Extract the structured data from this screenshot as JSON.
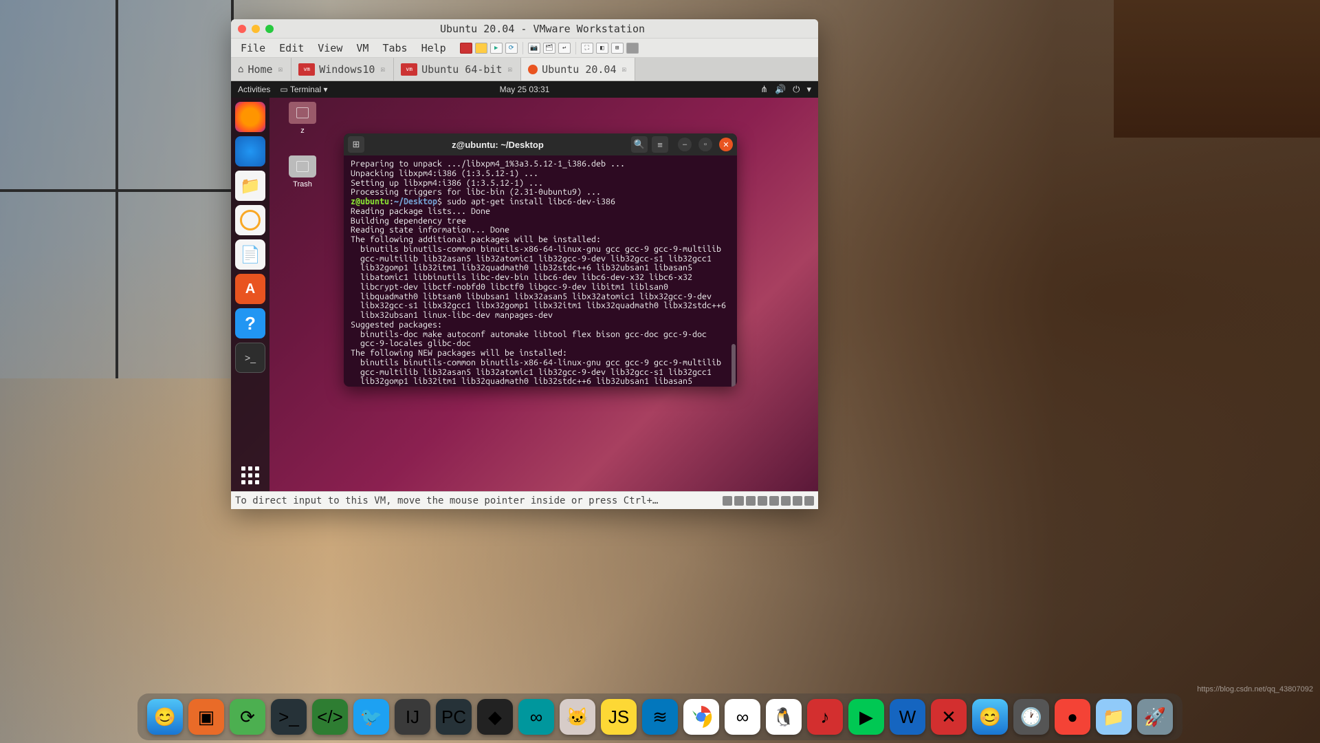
{
  "vmware": {
    "title": "Ubuntu 20.04 - VMware Workstation",
    "menu": {
      "file": "File",
      "edit": "Edit",
      "view": "View",
      "vm": "VM",
      "tabs": "Tabs",
      "help": "Help"
    },
    "tabs": [
      {
        "label": "Home"
      },
      {
        "label": "Windows10"
      },
      {
        "label": "Ubuntu 64-bit"
      },
      {
        "label": "Ubuntu 20.04"
      }
    ],
    "statusbar_text": "To direct input to this VM, move the mouse pointer inside or press Ctrl+…"
  },
  "ubuntu": {
    "topbar": {
      "activities": "Activities",
      "app": "Terminal",
      "clock": "May 25  03:31"
    },
    "desktop_icons": [
      {
        "label": "z"
      },
      {
        "label": "Trash"
      }
    ],
    "terminal": {
      "title": "z@ubuntu: ~/Desktop",
      "prompt_user": "z@ubuntu",
      "prompt_path": "~/Desktop",
      "prompt_sep": ":",
      "prompt_end": "$",
      "command": "sudo apt-get install libc6-dev-i386",
      "lines_pre": [
        "Preparing to unpack .../libxpm4_1%3a3.5.12-1_i386.deb ...",
        "Unpacking libxpm4:i386 (1:3.5.12-1) ...",
        "Setting up libxpm4:i386 (1:3.5.12-1) ...",
        "Processing triggers for libc-bin (2.31-0ubuntu9) ..."
      ],
      "lines_post": [
        "Reading package lists... Done",
        "Building dependency tree",
        "Reading state information... Done",
        "The following additional packages will be installed:",
        "  binutils binutils-common binutils-x86-64-linux-gnu gcc gcc-9 gcc-9-multilib",
        "  gcc-multilib lib32asan5 lib32atomic1 lib32gcc-9-dev lib32gcc-s1 lib32gcc1",
        "  lib32gomp1 lib32itm1 lib32quadmath0 lib32stdc++6 lib32ubsan1 libasan5",
        "  libatomic1 libbinutils libc-dev-bin libc6-dev libc6-dev-x32 libc6-x32",
        "  libcrypt-dev libctf-nobfd0 libctf0 libgcc-9-dev libitm1 liblsan0",
        "  libquadmath0 libtsan0 libubsan1 libx32asan5 libx32atomic1 libx32gcc-9-dev",
        "  libx32gcc-s1 libx32gcc1 libx32gomp1 libx32itm1 libx32quadmath0 libx32stdc++6",
        "  libx32ubsan1 linux-libc-dev manpages-dev",
        "Suggested packages:",
        "  binutils-doc make autoconf automake libtool flex bison gcc-doc gcc-9-doc",
        "  gcc-9-locales glibc-doc",
        "The following NEW packages will be installed:",
        "  binutils binutils-common binutils-x86-64-linux-gnu gcc gcc-9 gcc-9-multilib",
        "  gcc-multilib lib32asan5 lib32atomic1 lib32gcc-9-dev lib32gcc-s1 lib32gcc1",
        "  lib32gomp1 lib32itm1 lib32quadmath0 lib32stdc++6 lib32ubsan1 libasan5"
      ]
    }
  },
  "watermark": "https://blog.csdn.net/qq_43807092",
  "host_dock": {
    "items": [
      {
        "name": "finder",
        "bg": "linear-gradient(#4fc3f7,#1976d2)"
      },
      {
        "name": "vmware",
        "bg": "#e96b28"
      },
      {
        "name": "wechat-dev",
        "bg": "#4caf50"
      },
      {
        "name": "terminal-dev",
        "bg": "#263238"
      },
      {
        "name": "ide-green",
        "bg": "#2e7d32"
      },
      {
        "name": "twitter",
        "bg": "#1da1f2"
      },
      {
        "name": "intellij",
        "bg": "#3a3a3a"
      },
      {
        "name": "pycharm",
        "bg": "#263238"
      },
      {
        "name": "unity",
        "bg": "#222"
      },
      {
        "name": "arduino",
        "bg": "#00979d"
      },
      {
        "name": "cat-app",
        "bg": "#d7ccc8"
      },
      {
        "name": "js-app",
        "bg": "#fdd835"
      },
      {
        "name": "vscode",
        "bg": "#0277bd"
      },
      {
        "name": "chrome",
        "bg": "#fff"
      },
      {
        "name": "baidu-cloud",
        "bg": "#fff"
      },
      {
        "name": "qq",
        "bg": "#fff"
      },
      {
        "name": "netease",
        "bg": "#d32f2f"
      },
      {
        "name": "iqiyi",
        "bg": "#00c853"
      },
      {
        "name": "wps",
        "bg": "#1565c0"
      },
      {
        "name": "xmind",
        "bg": "#d32f2f"
      },
      {
        "name": "finder2",
        "bg": "linear-gradient(#4fc3f7,#1976d2)"
      },
      {
        "name": "clock",
        "bg": "#555"
      },
      {
        "name": "record",
        "bg": "#f44336"
      },
      {
        "name": "folder",
        "bg": "#90caf9"
      },
      {
        "name": "launchpad",
        "bg": "#78909c"
      }
    ]
  }
}
